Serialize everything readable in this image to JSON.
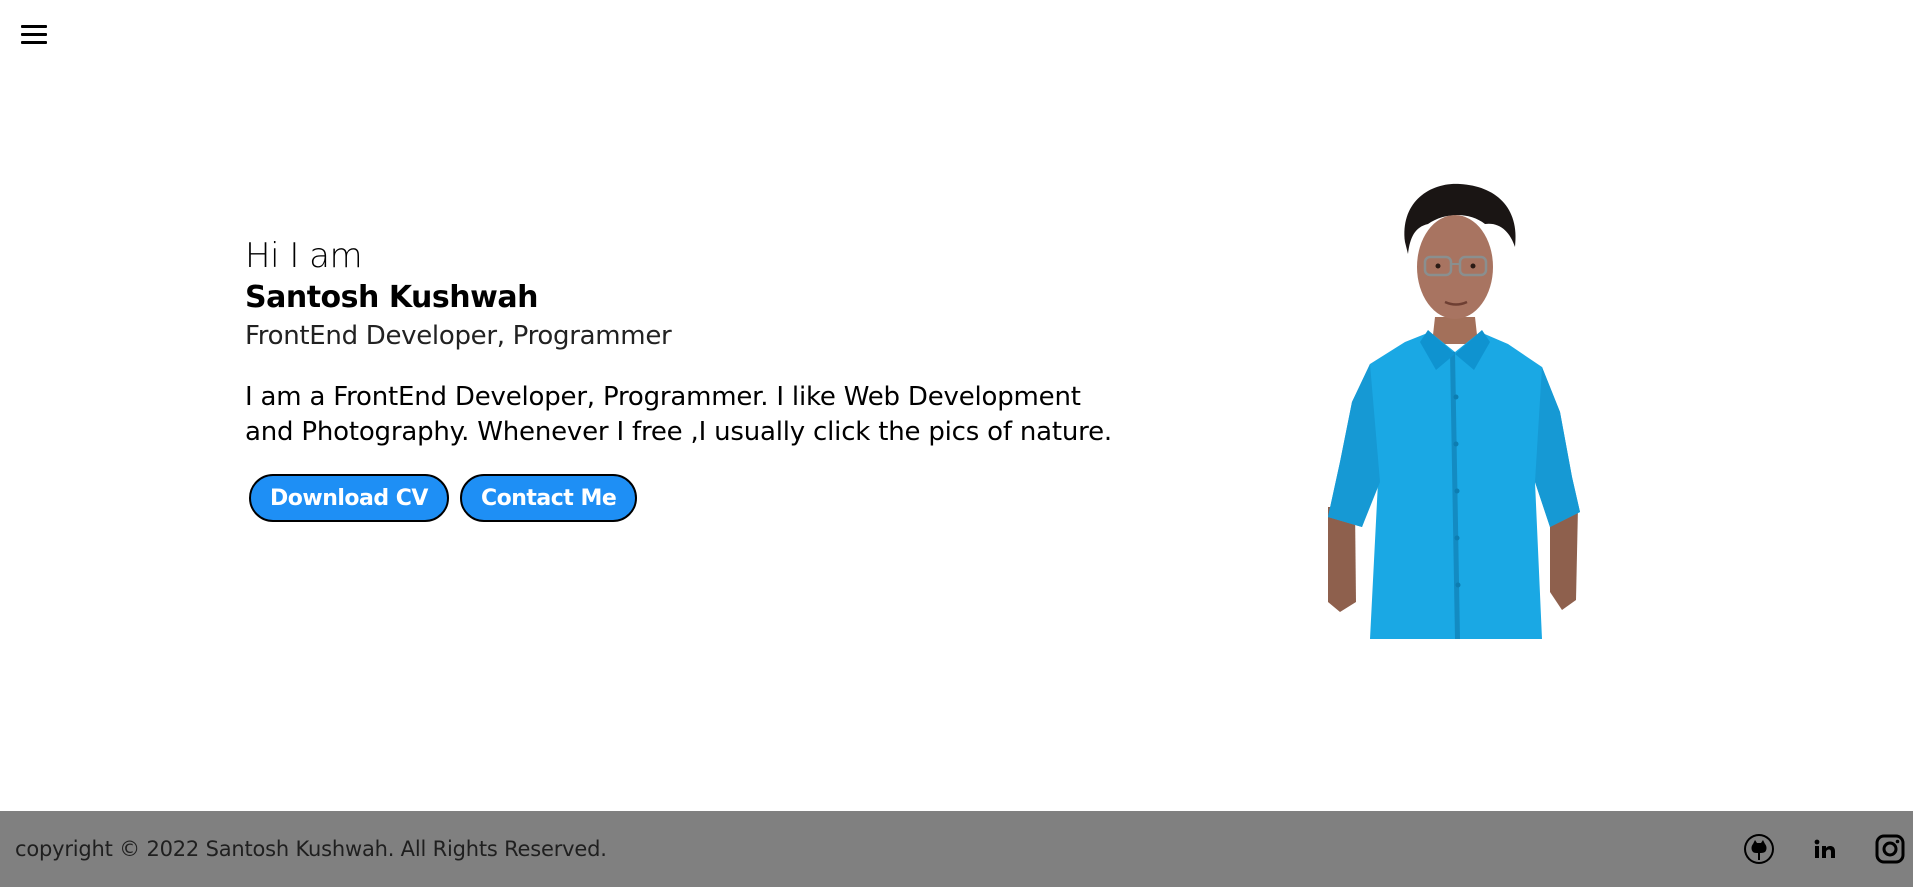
{
  "nav": {
    "menu_icon": "hamburger-menu-icon"
  },
  "hero": {
    "greeting": "Hi I am",
    "name": "Santosh Kushwah",
    "role": "FrontEnd Developer, Programmer",
    "bio_line1": "I am a FrontEnd Developer, Programmer. I like Web Development",
    "bio_line2": "and Photography. Whenever I free ,I usually click the pics of nature.",
    "download_label": "Download CV",
    "contact_label": "Contact Me"
  },
  "colors": {
    "accent": "#1e8ff5",
    "footer_bg": "#808080",
    "shirt": "#1aa8e4"
  },
  "footer": {
    "copyright": "copyright © 2022 Santosh Kushwah. All Rights Reserved.",
    "social_icons": [
      "github-icon",
      "linkedin-icon",
      "instagram-icon"
    ]
  }
}
